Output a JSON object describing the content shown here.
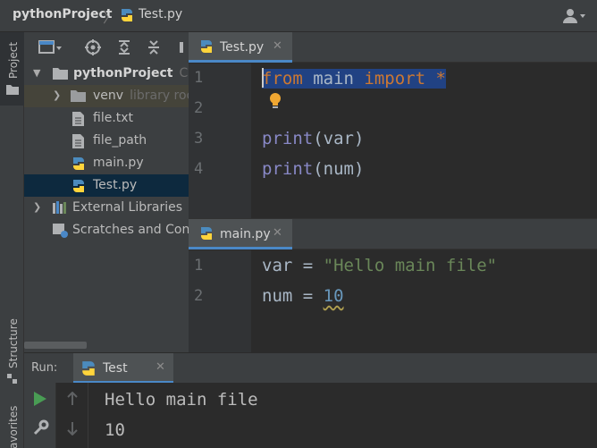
{
  "navbar": {
    "project_name": "pythonProject",
    "separator": "〉",
    "current_file": "Test.py"
  },
  "left_strip": {
    "project_tab": "Project",
    "structure_tab": "Structure",
    "favorites_tab": "avorites"
  },
  "project_tree": {
    "root_label": "pythonProject",
    "root_path_hint": "C:\\U",
    "venv_label": "venv",
    "venv_hint": "library roo",
    "file1": "file.txt",
    "file2": "file_path",
    "file3": "main.py",
    "file4": "Test.py",
    "external_libraries": "External Libraries",
    "scratches": "Scratches and Conso"
  },
  "editor_top": {
    "tab_label": "Test.py",
    "close_glyph": "✕",
    "lines": [
      {
        "n": "1",
        "parts": [
          "from",
          " main ",
          "import",
          " *"
        ]
      },
      {
        "n": "2"
      },
      {
        "n": "3",
        "parts": [
          "print",
          "(var)"
        ]
      },
      {
        "n": "4",
        "parts": [
          "print",
          "(num)"
        ]
      }
    ]
  },
  "editor_bottom": {
    "tab_label": "main.py",
    "close_glyph": "✕",
    "lines": [
      {
        "n": "1",
        "parts": [
          "var = ",
          "\"Hello main file\""
        ]
      },
      {
        "n": "2",
        "parts": [
          "num = ",
          "10"
        ]
      }
    ]
  },
  "run": {
    "label": "Run:",
    "tab_label": "Test",
    "close_glyph": "✕",
    "output": [
      "Hello main file",
      "10"
    ]
  },
  "colors": {
    "keyword": "#cc7832",
    "string": "#6a8759",
    "number": "#6897bb",
    "builtin": "#8888c6",
    "selection": "#214283",
    "accent": "#4a88c7"
  },
  "icons": [
    "python-file-icon",
    "folder-icon",
    "text-file-icon",
    "generic-file-icon",
    "library-icon",
    "scratches-icon",
    "lightbulb-icon",
    "run-icon",
    "wrench-icon",
    "up-arrow-icon",
    "down-arrow-icon",
    "user-icon",
    "settings-icon",
    "target-icon"
  ]
}
